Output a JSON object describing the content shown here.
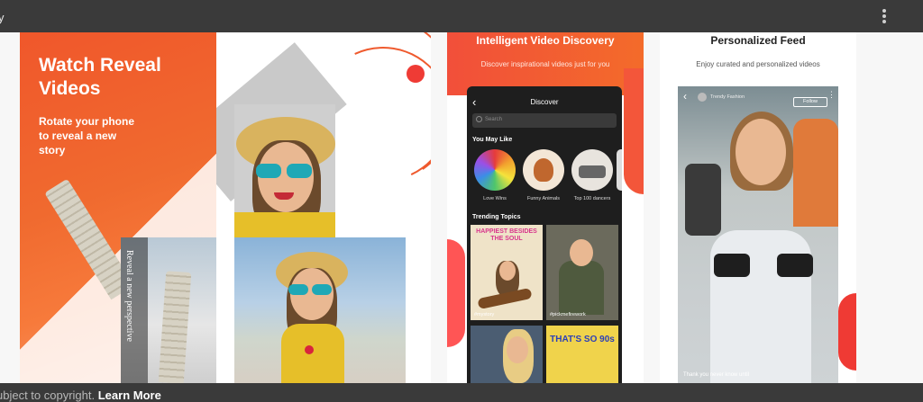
{
  "topbar": {
    "glyph": "y"
  },
  "panel1": {
    "headline": "Watch Reveal Videos",
    "sub": "Rotate your phone to reveal a new story",
    "card_text": "Reveal a new perspective"
  },
  "panel3": {
    "title": "Intelligent Video Discovery",
    "subtitle": "Discover inspirational videos just for you",
    "screen_title": "Discover",
    "search_placeholder": "Search",
    "you_may_like": "You May Like",
    "circles": [
      "Love Wins",
      "Funny Animals",
      "Top 100 dancers"
    ],
    "trending": "Trending Topics",
    "tiles": [
      "#mystory",
      "#pickmefirework"
    ],
    "tile_top_text": "HAPPIEST BESIDES THE SOUL",
    "tile_bottom_text": "THAT'S SO 90s"
  },
  "panel4": {
    "title": "Personalized Feed",
    "subtitle": "Enjoy curated and personalized videos",
    "username": "Trendy Fashion",
    "follow": "Follow",
    "caption": "Thank you never know until"
  },
  "footer": {
    "text": "ubject to copyright. ",
    "link": "Learn More"
  }
}
